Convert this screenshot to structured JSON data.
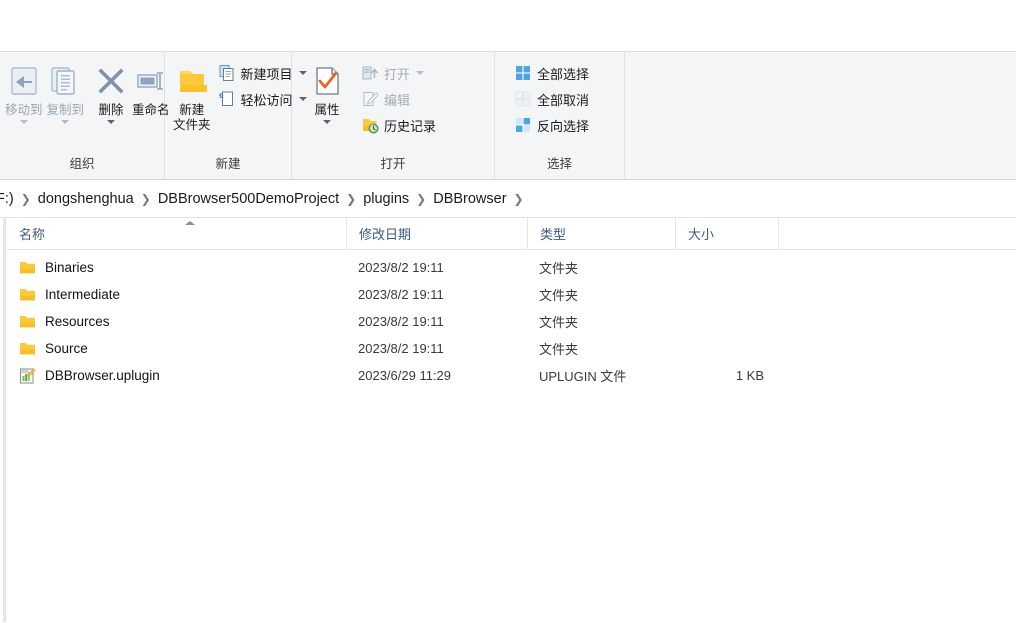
{
  "ribbon": {
    "groups": [
      {
        "label": "组织",
        "big_buttons": [
          {
            "label": "移动到",
            "icon": "move-to-icon",
            "disabled": true,
            "has_caret": true
          },
          {
            "label": "复制到",
            "icon": "copy-to-icon",
            "disabled": true,
            "has_caret": true
          },
          {
            "label": "删除",
            "icon": "delete-icon",
            "disabled": false,
            "has_caret": true
          },
          {
            "label": "重命名",
            "icon": "rename-icon",
            "disabled": false,
            "has_caret": false
          }
        ]
      },
      {
        "label": "新建",
        "big_buttons": [
          {
            "label": "新建\n文件夹",
            "label_line1": "新建",
            "label_line2": "文件夹",
            "icon": "new-folder-icon",
            "disabled": false,
            "has_caret": false
          }
        ],
        "small_buttons": [
          {
            "label": "新建项目",
            "icon": "new-item-icon",
            "disabled": false,
            "has_caret": true
          },
          {
            "label": "轻松访问",
            "icon": "easy-access-icon",
            "disabled": false,
            "has_caret": true
          }
        ]
      },
      {
        "label": "打开",
        "big_buttons": [
          {
            "label": "属性",
            "icon": "properties-icon",
            "disabled": false,
            "has_caret": true
          }
        ],
        "small_buttons": [
          {
            "label": "打开",
            "icon": "open-icon",
            "disabled": true,
            "has_caret": true
          },
          {
            "label": "编辑",
            "icon": "edit-icon",
            "disabled": true,
            "has_caret": false
          },
          {
            "label": "历史记录",
            "icon": "history-icon",
            "disabled": false,
            "has_caret": false
          }
        ]
      },
      {
        "label": "选择",
        "small_buttons": [
          {
            "label": "全部选择",
            "icon": "select-all-icon",
            "disabled": false,
            "has_caret": false
          },
          {
            "label": "全部取消",
            "icon": "select-none-icon",
            "disabled": false,
            "has_caret": false
          },
          {
            "label": "反向选择",
            "icon": "invert-selection-icon",
            "disabled": false,
            "has_caret": false
          }
        ]
      }
    ]
  },
  "address_bar": {
    "crumbs": [
      "F:)",
      "dongshenghua",
      "DBBrowser500DemoProject",
      "plugins",
      "DBBrowser"
    ],
    "separator": "❯"
  },
  "file_list": {
    "columns": [
      {
        "label": "名称",
        "sorted": true,
        "sort_direction": "ascending"
      },
      {
        "label": "修改日期",
        "sorted": false
      },
      {
        "label": "类型",
        "sorted": false
      },
      {
        "label": "大小",
        "sorted": false
      }
    ],
    "rows": [
      {
        "name": "Binaries",
        "icon": "folder-icon",
        "date": "2023/8/2 19:11",
        "type": "文件夹",
        "size": ""
      },
      {
        "name": "Intermediate",
        "icon": "folder-icon",
        "date": "2023/8/2 19:11",
        "type": "文件夹",
        "size": ""
      },
      {
        "name": "Resources",
        "icon": "folder-icon",
        "date": "2023/8/2 19:11",
        "type": "文件夹",
        "size": ""
      },
      {
        "name": "Source",
        "icon": "folder-icon",
        "date": "2023/8/2 19:11",
        "type": "文件夹",
        "size": ""
      },
      {
        "name": "DBBrowser.uplugin",
        "icon": "uplugin-file-icon",
        "date": "2023/6/29 11:29",
        "type": "UPLUGIN 文件",
        "size": "1 KB"
      }
    ]
  },
  "colors": {
    "ribbon_background": "#f3f5f7",
    "folder_yellow": "#fcc93c",
    "header_text": "#3f5a77",
    "accent_blue": "#4ba6e8",
    "properties_check": "#e8642a"
  }
}
